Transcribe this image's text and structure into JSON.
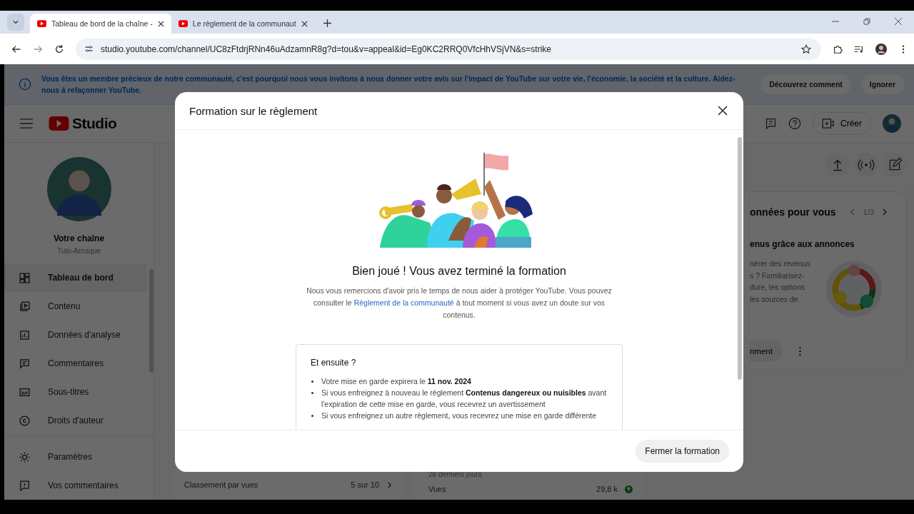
{
  "browser": {
    "tabs": [
      {
        "title": "Tableau de bord de la chaîne - ",
        "selected": true
      },
      {
        "title": "Le règlement de la communaut",
        "selected": false
      }
    ],
    "url": "studio.youtube.com/channel/UC8zFtdrjRNn46uAdzamnR8g?d=tou&v=appeal&id=Eg0KC2RRQ0VfcHhVSjVN&s=strike"
  },
  "banner": {
    "text": "Vous êtes un membre précieux de notre communauté, c'est pourquoi nous vous invitons à nous donner votre avis sur l'impact de YouTube sur votre vie, l'économie, la société et la culture. Aidez-nous à refaçonner YouTube.",
    "buttons": [
      "Découvrez comment",
      "Ignorer"
    ]
  },
  "studio": {
    "logo": "Studio",
    "create": "Créer",
    "channel": {
      "title": "Votre chaîne",
      "name": "Tuto-Arnaque"
    },
    "nav": [
      {
        "label": "Tableau de bord",
        "selected": true
      },
      {
        "label": "Contenu",
        "selected": false
      },
      {
        "label": "Données d'analyse",
        "selected": false
      },
      {
        "label": "Commentaires",
        "selected": false
      },
      {
        "label": "Sous-titres",
        "selected": false
      },
      {
        "label": "Droits d'auteur",
        "selected": false
      }
    ],
    "footer_nav": [
      {
        "label": "Paramètres",
        "selected": false
      },
      {
        "label": "Vos commentaires",
        "selected": false
      }
    ],
    "ranking": {
      "label": "Classement par vues",
      "value": "5 sur 10"
    },
    "period": "28 derniers jours",
    "views": {
      "label": "Vues",
      "value": "29,8 k"
    },
    "card": {
      "title": "onnées pour vous",
      "pager": "1/3",
      "subtitle": "enus grâce aux annonces",
      "lines": [
        "nérer des revenus",
        "s ? Familiarisez-",
        "dure, les options",
        "les sources de"
      ],
      "button": "nment"
    }
  },
  "modal": {
    "title": "Formation sur le règlement",
    "heading": "Bien joué ! Vous avez terminé la formation",
    "text_before": "Nous vous remercions d'avoir pris le temps de nous aider à protéger YouTube. Vous pouvez consulter le ",
    "link": "Règlement de la communauté",
    "text_after": " à tout moment si vous avez un doute sur vos contenus.",
    "next": {
      "title": "Et ensuite ?",
      "items": [
        "Votre mise en garde expirera le **11 nov. 2024**",
        "Si vous enfreignez à nouveau le règlement **Contenus dangereux ou nuisibles** avant l'expiration de cette mise en garde, vous recevrez un avertissement",
        "Si vous enfreignez un autre règlement, vous recevrez une mise en garde différente"
      ]
    },
    "button": "Fermer la formation"
  }
}
